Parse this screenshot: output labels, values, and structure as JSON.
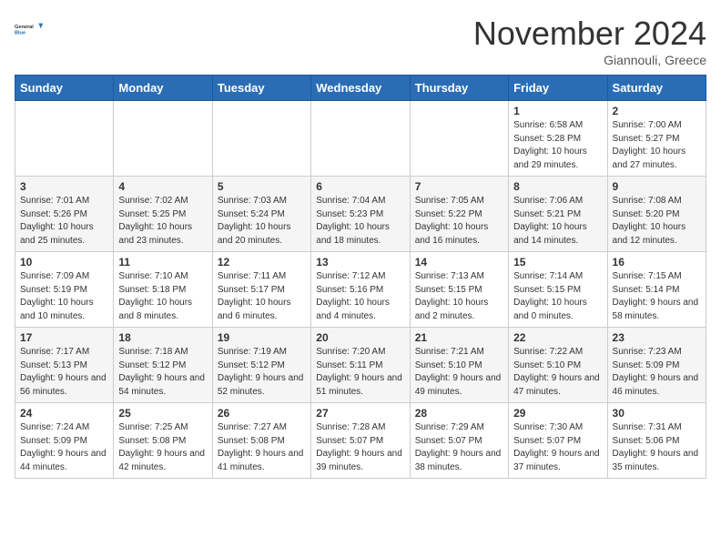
{
  "logo": {
    "general": "General",
    "blue": "Blue"
  },
  "header": {
    "title": "November 2024",
    "subtitle": "Giannouli, Greece"
  },
  "days_of_week": [
    "Sunday",
    "Monday",
    "Tuesday",
    "Wednesday",
    "Thursday",
    "Friday",
    "Saturday"
  ],
  "weeks": [
    [
      {
        "day": "",
        "info": ""
      },
      {
        "day": "",
        "info": ""
      },
      {
        "day": "",
        "info": ""
      },
      {
        "day": "",
        "info": ""
      },
      {
        "day": "",
        "info": ""
      },
      {
        "day": "1",
        "info": "Sunrise: 6:58 AM\nSunset: 5:28 PM\nDaylight: 10 hours and 29 minutes."
      },
      {
        "day": "2",
        "info": "Sunrise: 7:00 AM\nSunset: 5:27 PM\nDaylight: 10 hours and 27 minutes."
      }
    ],
    [
      {
        "day": "3",
        "info": "Sunrise: 7:01 AM\nSunset: 5:26 PM\nDaylight: 10 hours and 25 minutes."
      },
      {
        "day": "4",
        "info": "Sunrise: 7:02 AM\nSunset: 5:25 PM\nDaylight: 10 hours and 23 minutes."
      },
      {
        "day": "5",
        "info": "Sunrise: 7:03 AM\nSunset: 5:24 PM\nDaylight: 10 hours and 20 minutes."
      },
      {
        "day": "6",
        "info": "Sunrise: 7:04 AM\nSunset: 5:23 PM\nDaylight: 10 hours and 18 minutes."
      },
      {
        "day": "7",
        "info": "Sunrise: 7:05 AM\nSunset: 5:22 PM\nDaylight: 10 hours and 16 minutes."
      },
      {
        "day": "8",
        "info": "Sunrise: 7:06 AM\nSunset: 5:21 PM\nDaylight: 10 hours and 14 minutes."
      },
      {
        "day": "9",
        "info": "Sunrise: 7:08 AM\nSunset: 5:20 PM\nDaylight: 10 hours and 12 minutes."
      }
    ],
    [
      {
        "day": "10",
        "info": "Sunrise: 7:09 AM\nSunset: 5:19 PM\nDaylight: 10 hours and 10 minutes."
      },
      {
        "day": "11",
        "info": "Sunrise: 7:10 AM\nSunset: 5:18 PM\nDaylight: 10 hours and 8 minutes."
      },
      {
        "day": "12",
        "info": "Sunrise: 7:11 AM\nSunset: 5:17 PM\nDaylight: 10 hours and 6 minutes."
      },
      {
        "day": "13",
        "info": "Sunrise: 7:12 AM\nSunset: 5:16 PM\nDaylight: 10 hours and 4 minutes."
      },
      {
        "day": "14",
        "info": "Sunrise: 7:13 AM\nSunset: 5:15 PM\nDaylight: 10 hours and 2 minutes."
      },
      {
        "day": "15",
        "info": "Sunrise: 7:14 AM\nSunset: 5:15 PM\nDaylight: 10 hours and 0 minutes."
      },
      {
        "day": "16",
        "info": "Sunrise: 7:15 AM\nSunset: 5:14 PM\nDaylight: 9 hours and 58 minutes."
      }
    ],
    [
      {
        "day": "17",
        "info": "Sunrise: 7:17 AM\nSunset: 5:13 PM\nDaylight: 9 hours and 56 minutes."
      },
      {
        "day": "18",
        "info": "Sunrise: 7:18 AM\nSunset: 5:12 PM\nDaylight: 9 hours and 54 minutes."
      },
      {
        "day": "19",
        "info": "Sunrise: 7:19 AM\nSunset: 5:12 PM\nDaylight: 9 hours and 52 minutes."
      },
      {
        "day": "20",
        "info": "Sunrise: 7:20 AM\nSunset: 5:11 PM\nDaylight: 9 hours and 51 minutes."
      },
      {
        "day": "21",
        "info": "Sunrise: 7:21 AM\nSunset: 5:10 PM\nDaylight: 9 hours and 49 minutes."
      },
      {
        "day": "22",
        "info": "Sunrise: 7:22 AM\nSunset: 5:10 PM\nDaylight: 9 hours and 47 minutes."
      },
      {
        "day": "23",
        "info": "Sunrise: 7:23 AM\nSunset: 5:09 PM\nDaylight: 9 hours and 46 minutes."
      }
    ],
    [
      {
        "day": "24",
        "info": "Sunrise: 7:24 AM\nSunset: 5:09 PM\nDaylight: 9 hours and 44 minutes."
      },
      {
        "day": "25",
        "info": "Sunrise: 7:25 AM\nSunset: 5:08 PM\nDaylight: 9 hours and 42 minutes."
      },
      {
        "day": "26",
        "info": "Sunrise: 7:27 AM\nSunset: 5:08 PM\nDaylight: 9 hours and 41 minutes."
      },
      {
        "day": "27",
        "info": "Sunrise: 7:28 AM\nSunset: 5:07 PM\nDaylight: 9 hours and 39 minutes."
      },
      {
        "day": "28",
        "info": "Sunrise: 7:29 AM\nSunset: 5:07 PM\nDaylight: 9 hours and 38 minutes."
      },
      {
        "day": "29",
        "info": "Sunrise: 7:30 AM\nSunset: 5:07 PM\nDaylight: 9 hours and 37 minutes."
      },
      {
        "day": "30",
        "info": "Sunrise: 7:31 AM\nSunset: 5:06 PM\nDaylight: 9 hours and 35 minutes."
      }
    ]
  ]
}
